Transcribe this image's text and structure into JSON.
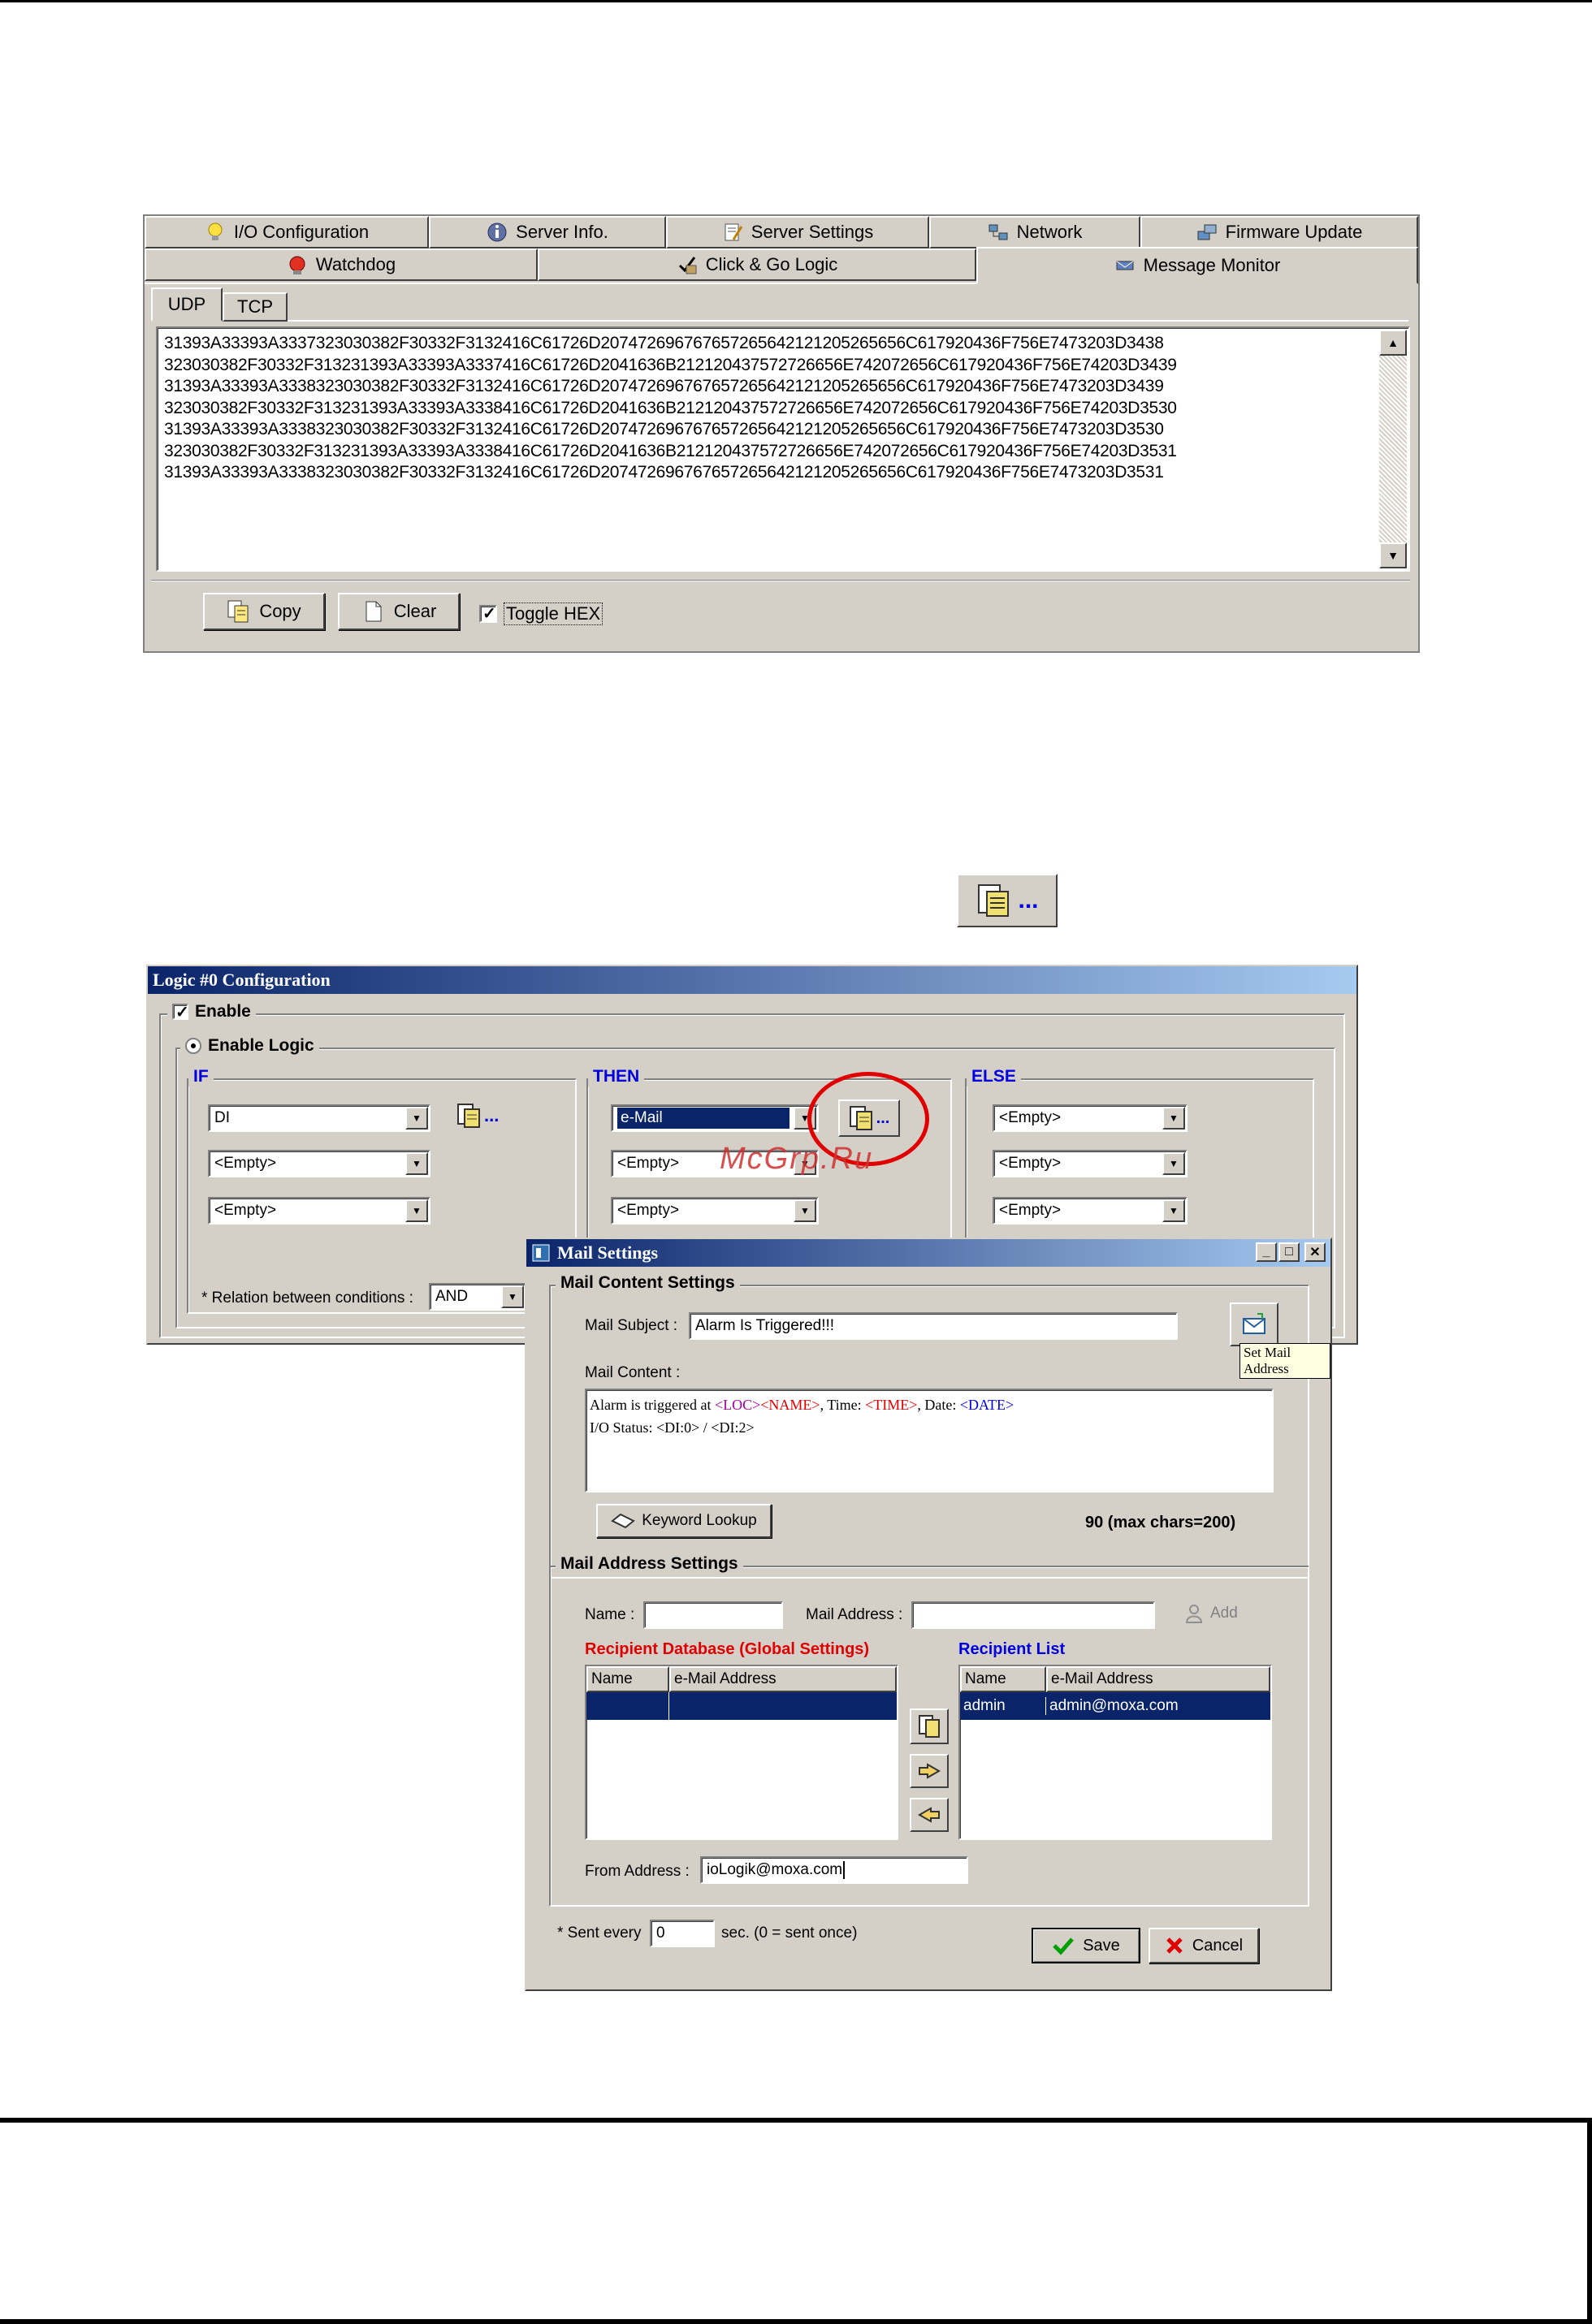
{
  "monitor": {
    "tabs_row1": [
      {
        "label": "I/O Configuration",
        "icon": "lightbulb-icon"
      },
      {
        "label": "Server Info.",
        "icon": "info-icon"
      },
      {
        "label": "Server Settings",
        "icon": "settings-icon"
      },
      {
        "label": "Network",
        "icon": "network-icon"
      },
      {
        "label": "Firmware Update",
        "icon": "firmware-icon"
      }
    ],
    "tabs_row2": [
      {
        "label": "Watchdog",
        "icon": "watchdog-icon"
      },
      {
        "label": "Click & Go Logic",
        "icon": "logic-icon"
      },
      {
        "label": "Message Monitor",
        "icon": "message-icon"
      }
    ],
    "subtabs": [
      "UDP",
      "TCP"
    ],
    "hex_lines": [
      "31393A33393A3337323030382F30332F3132416C61726D207472696767657265642121205265656C617920436F756E7473203D3438",
      "323030382F30332F313231393A33393A3337416C61726D2041636B212120437572726656E742072656C617920436F756E74203D3439",
      "31393A33393A3338323030382F30332F3132416C61726D207472696767657265642121205265656C617920436F756E7473203D3439",
      "323030382F30332F313231393A33393A3338416C61726D2041636B212120437572726656E742072656C617920436F756E74203D3530",
      "31393A33393A3338323030382F30332F3132416C61726D207472696767657265642121205265656C617920436F756E7473203D3530",
      "323030382F30332F313231393A33393A3338416C61726D2041636B212120437572726656E742072656C617920436F756E74203D3531",
      "31393A33393A3338323030382F30332F3132416C61726D207472696767657265642121205265656C617920436F756E7473203D3531"
    ],
    "copy_label": "Copy",
    "clear_label": "Clear",
    "toggle_hex_label": "Toggle HEX",
    "toggle_hex_checked": true
  },
  "logic": {
    "title": "Logic #0 Configuration",
    "enable_label": "Enable",
    "enable_logic_label": "Enable Logic",
    "if_label": "IF",
    "then_label": "THEN",
    "else_label": "ELSE",
    "if_values": [
      "DI",
      "<Empty>",
      "<Empty>"
    ],
    "then_values": [
      "e-Mail",
      "<Empty>",
      "<Empty>"
    ],
    "else_values": [
      "<Empty>",
      "<Empty>",
      "<Empty>"
    ],
    "relation_label": "* Relation between conditions :",
    "relation_value": "AND",
    "ellipsis": "..."
  },
  "watermark": "McGrp.Ru",
  "mail": {
    "title": "Mail Settings",
    "content_group": "Mail Content Settings",
    "subject_label": "Mail Subject :",
    "subject_value": "Alarm Is Triggered!!!",
    "set_mail_tooltip": "Set Mail Address",
    "content_label": "Mail Content :",
    "content_line1_a": "Alarm is triggered at ",
    "content_line1_loc": "<LOC>",
    "content_line1_name": "<NAME>",
    "content_line1_b": ", Time: ",
    "content_line1_time": "<TIME>",
    "content_line1_c": ", Date: ",
    "content_line1_date": "<DATE>",
    "content_line2": "I/O Status: <DI:0> / <DI:2>",
    "keyword_lookup_label": "Keyword Lookup",
    "char_count": "90 (max chars=200)",
    "address_group": "Mail Address Settings",
    "name_label": "Name :",
    "mail_address_label": "Mail Address :",
    "add_label": "Add",
    "recipient_db_label": "Recipient Database (Global Settings)",
    "recipient_list_label": "Recipient List",
    "col_name": "Name",
    "col_email": "e-Mail Address",
    "recipients": [
      {
        "name": "admin",
        "email": "admin@moxa.com"
      }
    ],
    "from_label": "From Address :",
    "from_value": "ioLogik@moxa.com",
    "sent_every_label": "* Sent every",
    "sent_every_value": "0",
    "sent_every_suffix": "sec. (0 = sent once)",
    "save_label": "Save",
    "cancel_label": "Cancel",
    "colors": {
      "title_start": "#0a246a",
      "title_end": "#a6caf0",
      "selection": "#0a246a",
      "group_red": "#e00000",
      "group_blue": "#0000e0"
    }
  }
}
